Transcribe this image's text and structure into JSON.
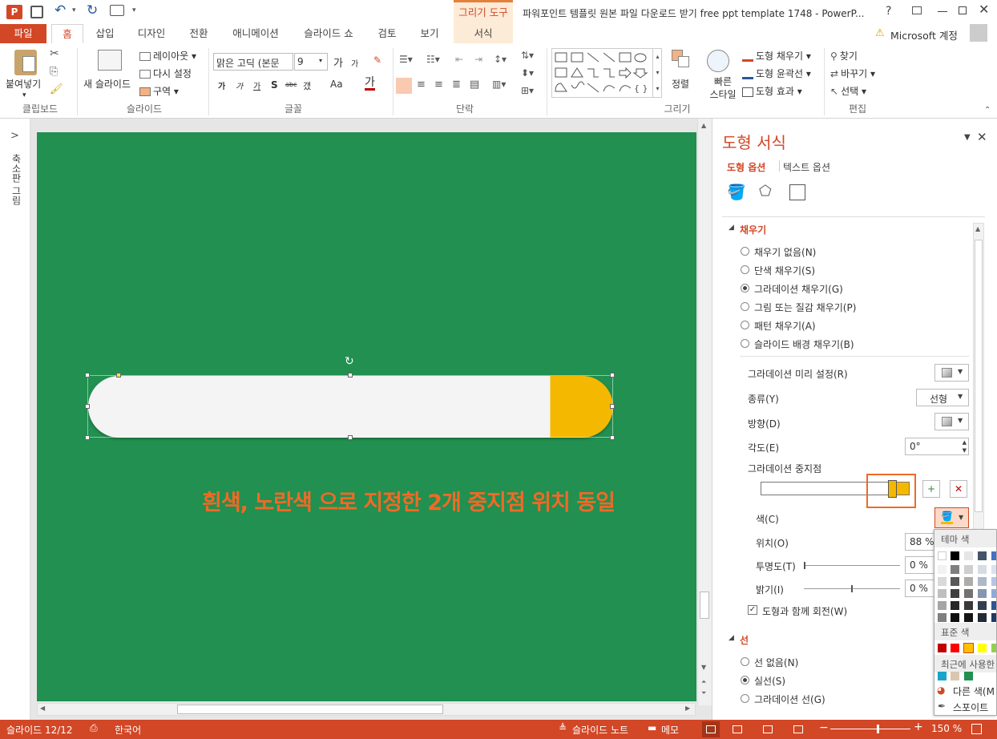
{
  "window": {
    "title": "파워포인트 템플릿 원본 파일 다운로드 받기 free ppt template 1748 - PowerP...",
    "help": "?",
    "app_icon": "P"
  },
  "context_tab": {
    "group": "그리기 도구",
    "tab": "서식"
  },
  "tabs": [
    "파일",
    "홈",
    "삽입",
    "디자인",
    "전환",
    "애니메이션",
    "슬라이드 쇼",
    "검토",
    "보기"
  ],
  "account": {
    "label": "Microsoft 계정"
  },
  "ribbon": {
    "clipboard": {
      "paste": "붙여넣기",
      "label": "클립보드"
    },
    "slides": {
      "new_slide": "새 슬라이드",
      "layout": "레이아웃",
      "reset": "다시 설정",
      "section": "구역",
      "label": "슬라이드"
    },
    "font": {
      "name": "맑은 고딕 (본문",
      "size": "9",
      "grow": "가",
      "shrink": "가",
      "bold": "가",
      "italic": "가",
      "underline": "가",
      "shadow": "S",
      "strike": "abc",
      "spacing": "갰",
      "case": "Aa",
      "color": "가",
      "label": "글꼴"
    },
    "paragraph": {
      "label": "단락"
    },
    "drawing": {
      "arrange": "정렬",
      "quick_styles": "빠른 스타일",
      "fill": "도형 채우기",
      "outline": "도형 윤곽선",
      "effects": "도형 효과",
      "label": "그리기"
    },
    "editing": {
      "find": "찾기",
      "replace": "바꾸기",
      "select": "선택",
      "label": "편집"
    }
  },
  "left_panel": {
    "label": "축소판 그림",
    "arrow": ">"
  },
  "slide": {
    "annotation": "흰색, 노란색 으로 지정한 2개 중지점 위치 동일",
    "bg_color": "#219050",
    "bar_color": "#f4f4f4",
    "cap_color": "#f5b800",
    "annotation_color": "#ef6a27"
  },
  "pane": {
    "title": "도형 서식",
    "tab_shape": "도형 옵션",
    "tab_text": "텍스트 옵션",
    "fill_section": "채우기",
    "fill_options": [
      "채우기 없음(N)",
      "단색 채우기(S)",
      "그라데이션 채우기(G)",
      "그림 또는 질감 채우기(P)",
      "패턴 채우기(A)",
      "슬라이드 배경 채우기(B)"
    ],
    "fill_selected": 2,
    "preset_label": "그라데이션 미리 설정(R)",
    "type_label": "종류(Y)",
    "type_value": "선형",
    "direction_label": "방향(D)",
    "angle_label": "각도(E)",
    "angle_value": "0°",
    "stops_label": "그라데이션 중지점",
    "color_label": "색(C)",
    "position_label": "위치(O)",
    "position_value": "88 %",
    "transparency_label": "투명도(T)",
    "transparency_value": "0 %",
    "brightness_label": "밝기(I)",
    "brightness_value": "0 %",
    "rotate_label": "도형과 함께 회전(W)",
    "line_section": "선",
    "line_options": [
      "선 없음(N)",
      "실선(S)",
      "그라데이션 선(G)"
    ],
    "line_selected": 1
  },
  "color_menu": {
    "theme": "테마 색",
    "standard": "표준 색",
    "recent": "최근에 사용한",
    "more": "다른 색(M",
    "eyedropper": "스포이트"
  },
  "status": {
    "slide": "슬라이드 12/12",
    "lang": "한국어",
    "notes": "슬라이드 노트",
    "comments": "메모",
    "zoom": "150 %"
  }
}
